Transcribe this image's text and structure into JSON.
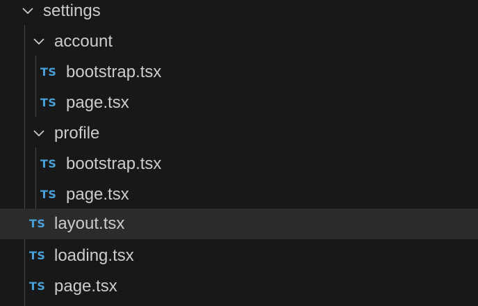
{
  "explorer": {
    "folders": {
      "settings": "settings",
      "account": "account",
      "profile": "profile"
    },
    "files": {
      "account_bootstrap": "bootstrap.tsx",
      "account_page": "page.tsx",
      "profile_bootstrap": "bootstrap.tsx",
      "profile_page": "page.tsx",
      "layout": "layout.tsx",
      "loading": "loading.tsx",
      "page": "page.tsx"
    },
    "file_badge": "TS",
    "selected_item": "layout.tsx"
  },
  "colors": {
    "background": "#181818",
    "selected_row": "#2b2b2b",
    "text": "#cccccc",
    "ts_badge": "#4aa0d8",
    "indent_guide": "#474747"
  },
  "icons": {
    "expanded_folder": "chevron-down-icon",
    "file": "typescript-file-icon"
  }
}
